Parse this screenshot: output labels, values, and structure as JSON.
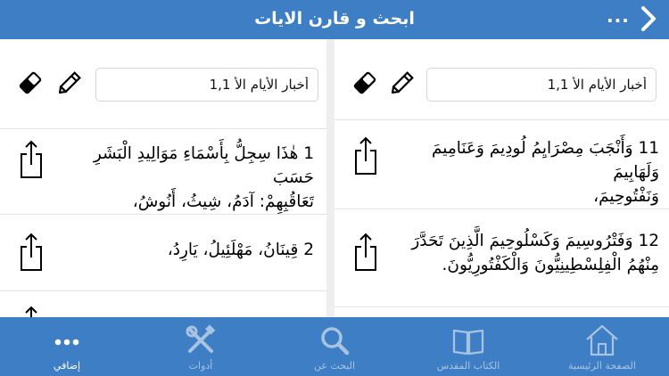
{
  "header": {
    "title": "ابحث و قارن الايات",
    "more_label": "..."
  },
  "panes": {
    "left": {
      "reference": "أخبار الأيام الأ 1,1",
      "verses": [
        {
          "line1": "1 هٰذَا سِجِلُّ بِأَسْمَاءِ مَوَالِيدِ الْبَشَرِ حَسَبَ",
          "line2": "تَعَاقُبِهِمْ: آدَمُ، شِيثُ، أَنُوشُ،"
        },
        {
          "line1": "2 قِينَانُ، مَهْلَئِيلُ، يَارِدُ،",
          "line2": ""
        }
      ]
    },
    "right": {
      "reference": "أخبار الأيام الأ 1,1",
      "verses": [
        {
          "line1": "11 وَأَنْجَبَ مِصْرَايِمُ لُودِيمَ وَعَنَامِيمَ وَلَهَابِيمَ",
          "line2": "وَنَفْتُوحِيمَ،"
        },
        {
          "line1": "12 وَفَتْرُوسِيمَ وَكَسْلُوحِيمَ الَّذِينَ تَحَدَّرَ",
          "line2": "مِنْهُمُ الْفِلِسْطِينِيُّونَ وَالْكَفْتُورِيُّونَ."
        }
      ]
    }
  },
  "tabbar": {
    "tabs": [
      {
        "label": "إضافي",
        "icon": "more-dots-icon",
        "active": true
      },
      {
        "label": "أدوات",
        "icon": "tools-icon",
        "active": false
      },
      {
        "label": "البحث عن",
        "icon": "search-icon",
        "active": false
      },
      {
        "label": "الكتاب المقدس",
        "icon": "book-icon",
        "active": false
      },
      {
        "label": "الصفحة الرئيسية",
        "icon": "home-icon",
        "active": false
      }
    ]
  },
  "colors": {
    "accent": "#3d7ec5",
    "tab_inactive": "#a8c3e2",
    "divider": "#eeeeee"
  }
}
